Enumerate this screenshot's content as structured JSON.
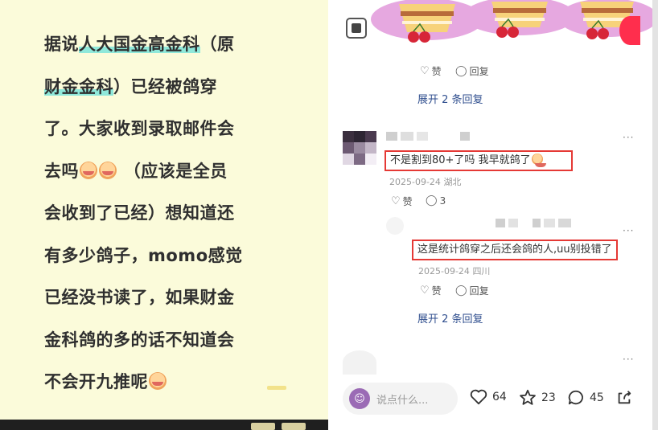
{
  "post": {
    "lines": [
      {
        "pre": "据说",
        "hl": "人大国金高金科",
        "post": "（原"
      },
      {
        "pre": "",
        "hl": "财金金科",
        "post": "）已经被鸽穿"
      },
      {
        "pre": "了。大家收到录取邮件会",
        "hl": "",
        "post": ""
      },
      {
        "pre": "去吗",
        "hl": "",
        "post": " （应该是全员",
        "emoji": 2
      },
      {
        "pre": "会收到了已经）想知道还",
        "hl": "",
        "post": ""
      },
      {
        "pre": "有多少鸽子，momo感觉",
        "hl": "",
        "post": ""
      },
      {
        "pre": "已经没书读了，如果财金",
        "hl": "",
        "post": ""
      },
      {
        "pre": "金科鸽的多的话不知道会",
        "hl": "",
        "post": ""
      },
      {
        "pre": "不会开九推呢",
        "hl": "",
        "post": "",
        "emoji_end": 1
      }
    ]
  },
  "comments": {
    "reply1_actions": {
      "like": "赞",
      "reply": "回复"
    },
    "expand_top": "展开 2 条回复",
    "comment2": {
      "text": "不是割到80+了吗 我早就鸽了",
      "date": "2025-09-24",
      "location": "湖北",
      "like": "赞",
      "reply_count": "3"
    },
    "reply2": {
      "text": "这是统计鸽穿之后还会鸽的人,uu别投错了",
      "date": "2025-09-24",
      "location": "四川",
      "like": "赞",
      "reply": "回复"
    },
    "expand_bottom": "展开 2 条回复",
    "more": "···"
  },
  "bottom_bar": {
    "placeholder": "说点什么...",
    "likes": "64",
    "favorites": "23",
    "comments": "45"
  },
  "colors": {
    "accent_highlight": "#8fe8da",
    "red_box": "#e53935",
    "link": "#2f4e8e",
    "post_bg": "#fbfbda"
  }
}
